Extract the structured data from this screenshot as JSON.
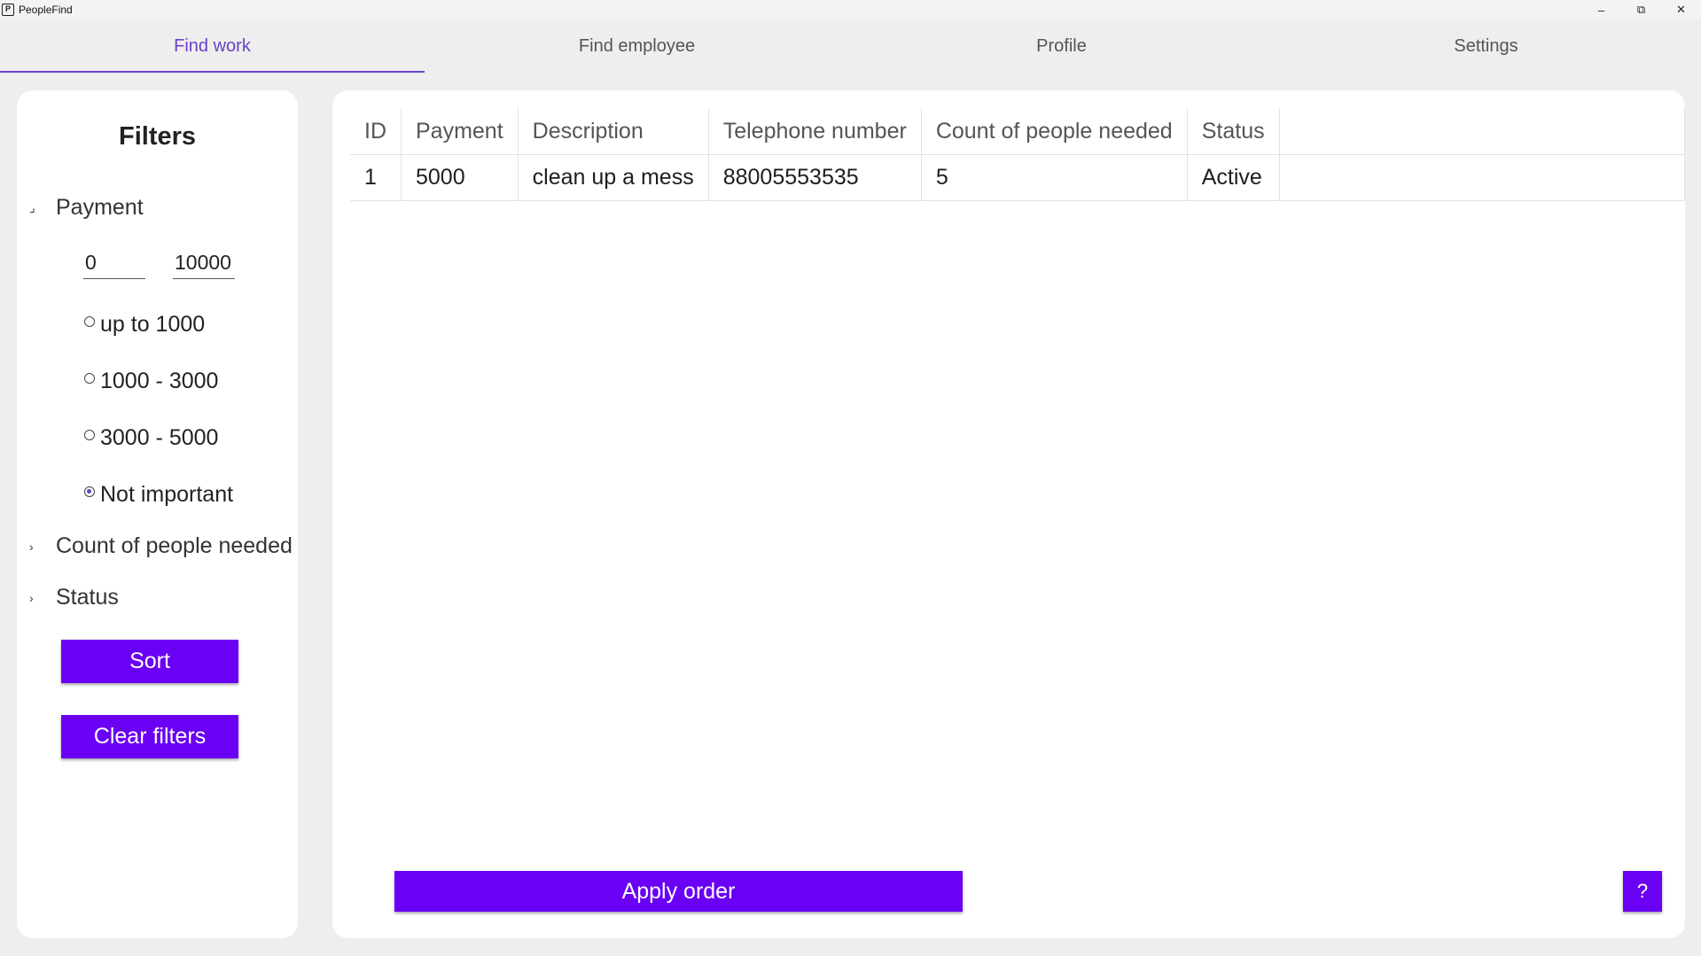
{
  "window": {
    "title": "PeopleFind",
    "icon_label": "P",
    "controls": {
      "minimize": "–",
      "restore": "⧉",
      "close": "✕"
    }
  },
  "tabs": [
    {
      "label": "Find work",
      "active": true
    },
    {
      "label": "Find employee",
      "active": false
    },
    {
      "label": "Profile",
      "active": false
    },
    {
      "label": "Settings",
      "active": false
    }
  ],
  "filters": {
    "title": "Filters",
    "payment": {
      "label": "Payment",
      "expanded": true,
      "min_value": "0",
      "max_value": "10000",
      "options": [
        {
          "label": "up to 1000",
          "checked": false
        },
        {
          "label": "1000 - 3000",
          "checked": false
        },
        {
          "label": "3000 - 5000",
          "checked": false
        },
        {
          "label": "Not important",
          "checked": true
        }
      ]
    },
    "count_section": {
      "label": "Count of people needed",
      "expanded": false
    },
    "status_section": {
      "label": "Status",
      "expanded": false
    },
    "sort_label": "Sort",
    "clear_label": "Clear filters"
  },
  "table": {
    "columns": [
      "ID",
      "Payment",
      "Description",
      "Telephone number",
      "Count of people needed",
      "Status"
    ],
    "rows": [
      [
        "1",
        "5000",
        "clean up a mess",
        "88005553535",
        "5",
        "Active"
      ]
    ]
  },
  "actions": {
    "apply_label": "Apply order",
    "help_label": "?"
  },
  "colors": {
    "accent": "#6a00f4",
    "tab_active": "#6a42c6",
    "background": "#eeeeee",
    "panel": "#ffffff"
  }
}
